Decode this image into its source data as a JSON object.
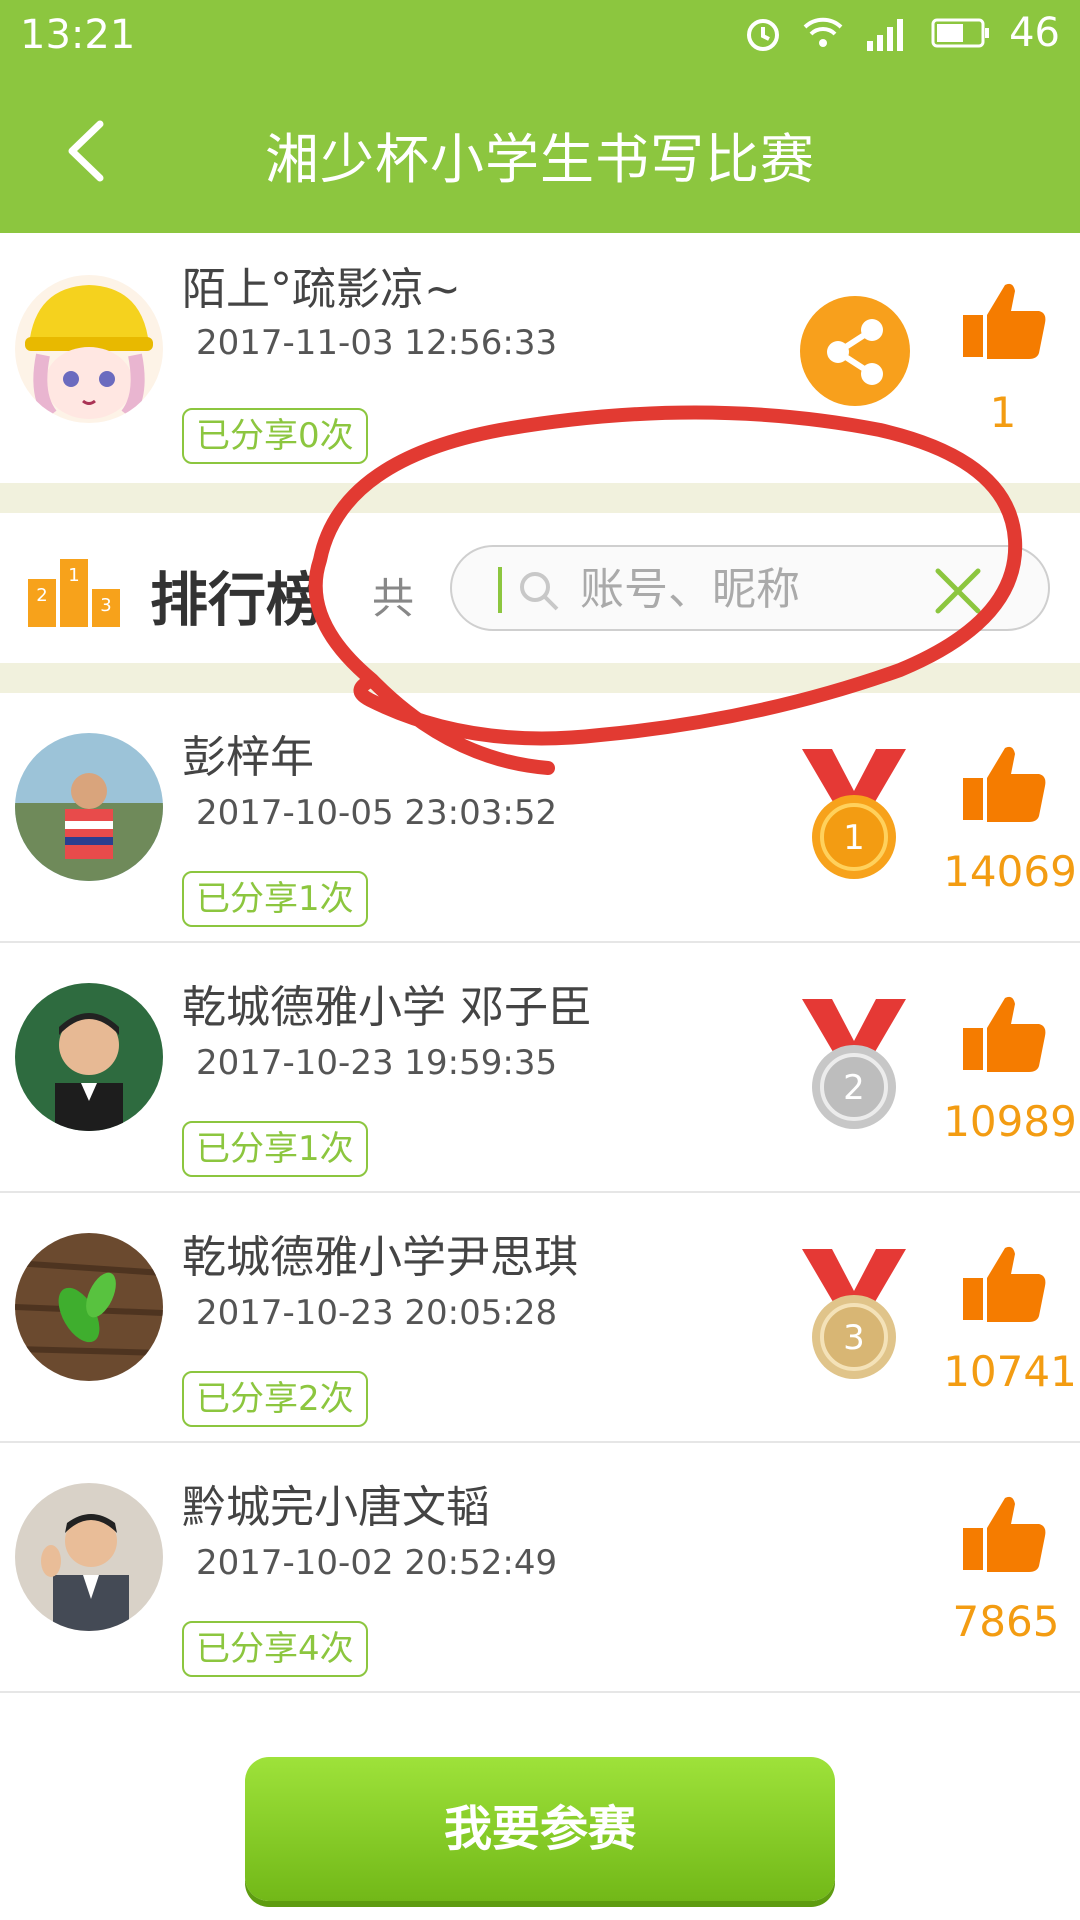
{
  "status_bar": {
    "time": "13:21",
    "battery": "46"
  },
  "header": {
    "title": "湘少杯小学生书写比赛"
  },
  "current_user": {
    "name": "陌上°疏影凉~",
    "date": "2017-11-03 12:56:33",
    "shared": "已分享0次",
    "likes": "1"
  },
  "ranking": {
    "title": "排行榜",
    "total_prefix": "共",
    "search_placeholder": "账号、昵称"
  },
  "entries": [
    {
      "name": "彭梓年",
      "date": "2017-10-05 23:03:52",
      "shared": "已分享1次",
      "likes": "14069",
      "medal": "1"
    },
    {
      "name": "乾城德雅小学 邓子臣",
      "date": "2017-10-23 19:59:35",
      "shared": "已分享1次",
      "likes": "10989",
      "medal": "2"
    },
    {
      "name": "乾城德雅小学尹思琪",
      "date": "2017-10-23 20:05:28",
      "shared": "已分享2次",
      "likes": "10741",
      "medal": "3"
    },
    {
      "name": "黔城完小唐文韬",
      "date": "2017-10-02 20:52:49",
      "shared": "已分享4次",
      "likes": "7865"
    }
  ],
  "join_button": {
    "label": "我要参赛"
  },
  "colors": {
    "primary_green": "#8cc63f",
    "orange": "#f39c12",
    "like_orange": "#f57c00",
    "annotation_red": "#e23a32"
  }
}
